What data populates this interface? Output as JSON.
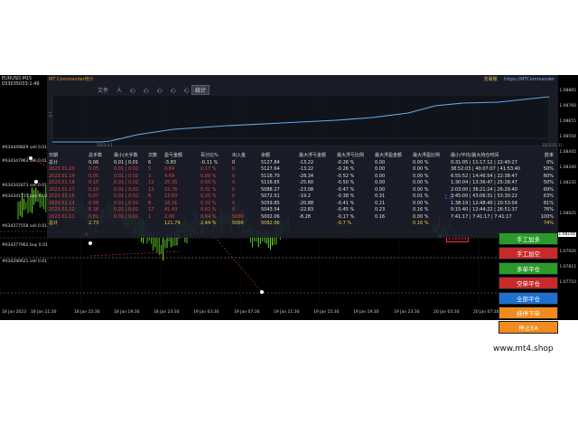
{
  "symbol_info": {
    "line1": "EURUSD,M15",
    "line2": "033035033-1.49"
  },
  "panel": {
    "title": "MT Commander统计",
    "right_cn": "交易账",
    "right_url": "https://MTCommander",
    "menu": [
      "文件",
      "人",
      "心",
      "心",
      "心",
      "心",
      "心",
      "账户"
    ],
    "stats_button": "统计",
    "equity_axis_left": "1.5",
    "equity_axis_date_a": "2023.0.1",
    "equity_axis_date_b": "2023.01.31",
    "blue_hint": "1.5"
  },
  "table": {
    "headers": [
      "日期",
      "总手数",
      "最小/大手数",
      "次数",
      "盈亏金额",
      "百分比%",
      "出入金",
      "余额",
      "最大浮亏金额",
      "最大浮亏比例",
      "最大浮盈金额",
      "最大浮盈比例",
      "最小/平均/最大持仓时间",
      "胜率"
    ],
    "rows": [
      {
        "style": "total",
        "cells": [
          "总计",
          "0.06",
          "0.01 | 0.01",
          "6",
          "-3.83",
          "-0.11 %",
          "0",
          "5127.84",
          "-13.22",
          "-0.26 %",
          "0.00",
          "0.00 %",
          "0:31:05 | 11:17:12 | 22:40:27",
          "0%"
        ]
      },
      {
        "style": "red",
        "cells": [
          "2023.01.20",
          "0.05",
          "0.01 | 0.02",
          "5",
          "0.84",
          "0.17 %",
          "0",
          "5127.64",
          "-13.22",
          "-0.26 %",
          "0.00",
          "0.00 %",
          "38:52:03 | 40:07:07 | 41:53:40",
          "50%"
        ]
      },
      {
        "style": "red",
        "cells": [
          "2023.01.19",
          "0.05",
          "0.01 | 0.02",
          "3",
          "4.69",
          "0.09 %",
          "0",
          "5116.70",
          "-28.34",
          "-0.52 %",
          "0.00",
          "0.00 %",
          "6:55:52 | 14:46:54 | 22:38:47",
          "60%"
        ]
      },
      {
        "style": "red",
        "cells": [
          "2023.01.18",
          "0.15",
          "0.01 | 0.02",
          "12",
          "25.35",
          "0.50 %",
          "0",
          "5116.65",
          "-25.60",
          "-0.50 %",
          "0.00",
          "0.00 %",
          "1:30:04 | 13:36:47 | 25:28:47",
          "50%"
        ]
      },
      {
        "style": "red",
        "cells": [
          "2023.01.17",
          "0.15",
          "0.01 | 0.02",
          "13",
          "15.76",
          "0.31 %",
          "0",
          "5088.27",
          "-23.08",
          "-0.47 %",
          "0.00",
          "0.00 %",
          "2:03:00 | 36:21:24 | 26:29:40",
          "69%"
        ]
      },
      {
        "style": "red",
        "cells": [
          "2023.01.16",
          "0.07",
          "0.01 | 0.02",
          "6",
          "12.83",
          "0.25 %",
          "0",
          "5072.51",
          "-19.2",
          "-0.38 %",
          "0.31",
          "0.01 %",
          "3:45:00 | 43:06:31 | 53:30:22",
          "63%"
        ]
      },
      {
        "style": "red",
        "cells": [
          "2023.01.13",
          "0.08",
          "0.01 | 0.02",
          "8",
          "16.31",
          "0.32 %",
          "0",
          "5059.85",
          "-20.88",
          "-0.41 %",
          "0.21",
          "0.00 %",
          "1:38:19 | 12:48:40 | 20:53:04",
          "81%"
        ]
      },
      {
        "style": "red",
        "cells": [
          "2023.01.12",
          "0.18",
          "0.01 | 0.02",
          "17",
          "41.43",
          "0.82 %",
          "0",
          "5043.54",
          "-22.83",
          "-0.45 %",
          "0.23",
          "0.16 %",
          "0:15:40 | 12:44:22 | 26:51:37",
          "76%"
        ]
      },
      {
        "style": "red",
        "cells": [
          "2023.01.11",
          "0.01",
          "0.01 | 0.01",
          "1",
          "2.06",
          "0.04 %",
          "5000",
          "5002.06",
          "-8.28",
          "-0.17 %",
          "0.16",
          "0.00 %",
          "7:41:17 | 7:41:17 | 7:41:17",
          "100%"
        ]
      },
      {
        "style": "bot",
        "cells": [
          "总计",
          "2.73",
          "",
          "",
          "121.79",
          "2.44 %",
          "5000",
          "5082.06",
          "",
          "-0.7 %",
          "",
          "0.16 %",
          "",
          "74%"
        ]
      }
    ]
  },
  "buttons": [
    {
      "label": "手工加多",
      "color": "#2b9a2b",
      "name": "manual-buy-button"
    },
    {
      "label": "手工加空",
      "color": "#c62a2a",
      "name": "manual-sell-button"
    },
    {
      "label": "多单平仓",
      "color": "#2b9a2b",
      "name": "close-buy-button"
    },
    {
      "label": "空单平仓",
      "color": "#c62a2a",
      "name": "close-sell-button"
    },
    {
      "label": "全部平仓",
      "color": "#1e6fd0",
      "name": "close-all-button"
    },
    {
      "label": "挂停下单",
      "color": "#f08c1e",
      "name": "pause-order-button"
    },
    {
      "label": "停止EA",
      "color": "#f08c1e",
      "name": "stop-ea-button"
    }
  ],
  "price_axis": [
    "1.08865",
    "1.08760",
    "1.08655",
    "1.08550",
    "1.08445",
    "1.08340",
    "1.08235",
    "1.08144",
    "1.08025",
    "1.07920",
    "1.07815",
    "1.07710"
  ],
  "current_price": "1.08144",
  "red_price": "1.08129",
  "time_axis": [
    "18 Jan 2023",
    "18 Jan 11:30",
    "18 Jan 15:30",
    "18 Jan 19:30",
    "18 Jan 23:30",
    "19 Jan 03:30",
    "19 Jan 07:30",
    "19 Jan 11:30",
    "19 Jan 15:30",
    "19 Jan 19:30",
    "19 Jan 23:30",
    "20 Jan 03:30",
    "20 Jan 07:30",
    "20 Jan 11:30"
  ],
  "position_labels": [
    {
      "text": "#634449829 sell 0.01"
    },
    {
      "text": "#634347963 sell 0.01"
    },
    {
      "text": "#634342873 sell 0.01"
    },
    {
      "text": "#634341725 buy 0.01"
    },
    {
      "text": "#634377558 sell 0.01"
    },
    {
      "text": "#634377962 buy 0.01"
    },
    {
      "text": "#634290621 sell 0.01"
    }
  ],
  "watermark": "www.mt4.shop"
}
